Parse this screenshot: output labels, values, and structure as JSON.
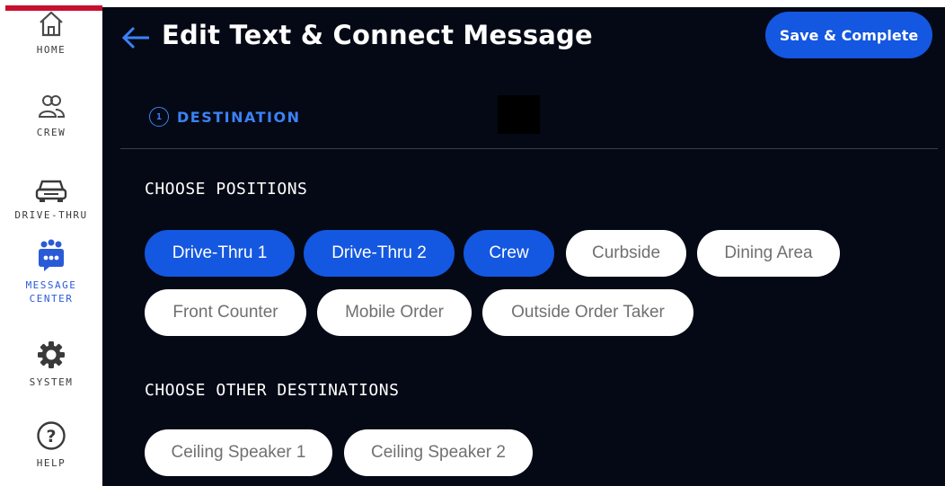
{
  "sidebar": {
    "items": [
      {
        "label": "HOME",
        "icon": "home-icon"
      },
      {
        "label": "CREW",
        "icon": "crew-icon"
      },
      {
        "label": "DRIVE-THRU",
        "icon": "car-icon"
      },
      {
        "label": "MESSAGE",
        "label2": "CENTER",
        "icon": "message-center-icon",
        "active": true
      },
      {
        "label": "SYSTEM",
        "icon": "gear-icon"
      },
      {
        "label": "HELP",
        "icon": "help-icon"
      }
    ]
  },
  "header": {
    "title": "Edit Text & Connect Message",
    "save_label": "Save & Complete"
  },
  "step": {
    "number": "1",
    "label": "DESTINATION"
  },
  "positions": {
    "title": "CHOOSE POSITIONS",
    "chips": [
      {
        "label": "Drive-Thru 1",
        "selected": true
      },
      {
        "label": "Drive-Thru 2",
        "selected": true
      },
      {
        "label": "Crew",
        "selected": true
      },
      {
        "label": "Curbside",
        "selected": false
      },
      {
        "label": "Dining Area",
        "selected": false
      },
      {
        "label": "Front Counter",
        "selected": false
      },
      {
        "label": "Mobile Order",
        "selected": false
      },
      {
        "label": "Outside Order Taker",
        "selected": false
      }
    ]
  },
  "other_destinations": {
    "title": "CHOOSE OTHER DESTINATIONS",
    "chips": [
      {
        "label": "Ceiling Speaker 1",
        "selected": false
      },
      {
        "label": "Ceiling Speaker 2",
        "selected": false
      }
    ]
  },
  "colors": {
    "accent": "#1457e0",
    "background": "#050915",
    "brand_red": "#c8102e"
  }
}
